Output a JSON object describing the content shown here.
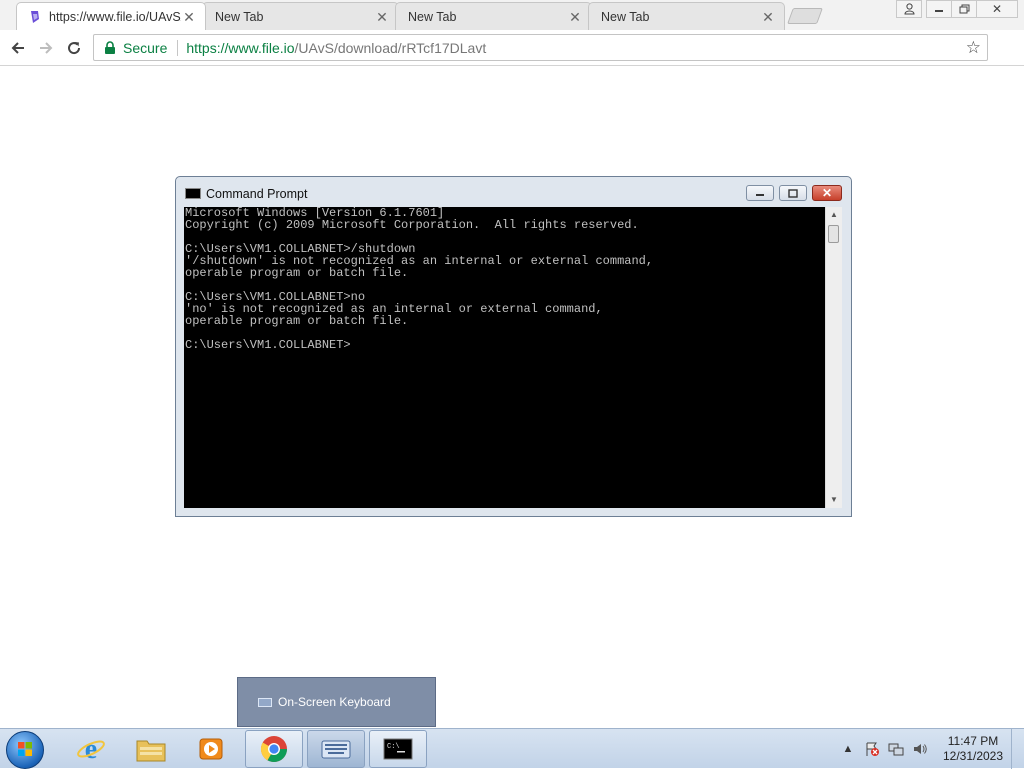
{
  "browser": {
    "tabs": [
      {
        "title": "https://www.file.io/UAvS/",
        "active": true
      },
      {
        "title": "New Tab",
        "active": false
      },
      {
        "title": "New Tab",
        "active": false
      },
      {
        "title": "New Tab",
        "active": false
      }
    ],
    "address": {
      "secure_label": "Secure",
      "url_host": "https://www.file.io",
      "url_path": "/UAvS/download/rRTcf17DLavt"
    }
  },
  "cmd_window": {
    "title": "Command Prompt",
    "console_lines": [
      "Microsoft Windows [Version 6.1.7601]",
      "Copyright (c) 2009 Microsoft Corporation.  All rights reserved.",
      "",
      "C:\\Users\\VM1.COLLABNET>/shutdown",
      "'/shutdown' is not recognized as an internal or external command,",
      "operable program or batch file.",
      "",
      "C:\\Users\\VM1.COLLABNET>no",
      "'no' is not recognized as an internal or external command,",
      "operable program or batch file.",
      "",
      "C:\\Users\\VM1.COLLABNET>"
    ]
  },
  "taskbar": {
    "preview_label": "On-Screen Keyboard",
    "clock_time": "11:47 PM",
    "clock_date": "12/31/2023",
    "apps": [
      "internet-explorer",
      "file-explorer",
      "media-player",
      "chrome",
      "on-screen-keyboard",
      "command-prompt"
    ]
  },
  "colors": {
    "secure_green": "#0b8043",
    "console_bg": "#000000",
    "console_fg": "#c0c0c0",
    "taskbar_top": "#d7e3f1"
  }
}
